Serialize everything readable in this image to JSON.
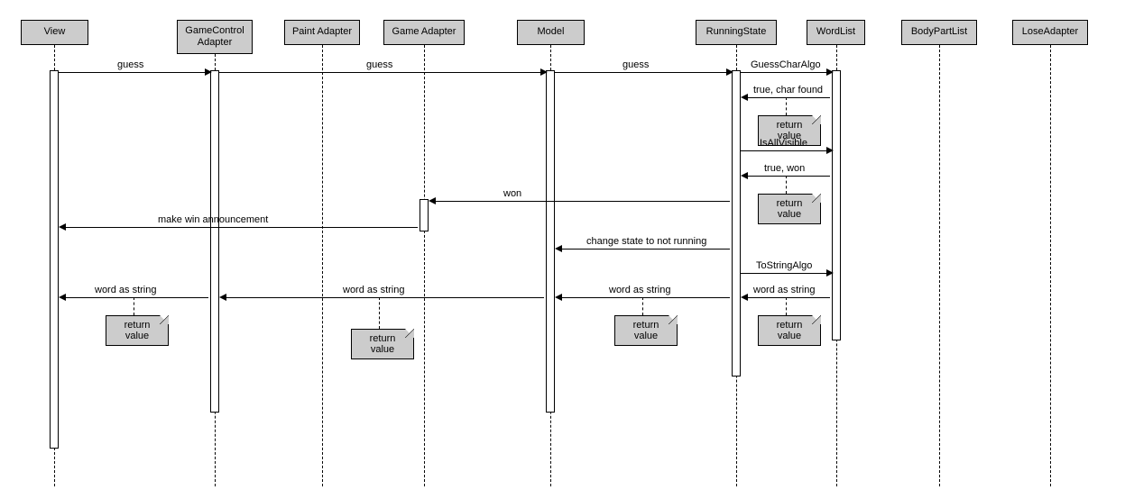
{
  "participants": {
    "view": "View",
    "gamecontrol": "GameControl Adapter",
    "paint": "Paint Adapter",
    "game": "Game Adapter",
    "model": "Model",
    "running": "RunningState",
    "wordlist": "WordList",
    "bodypart": "BodyPartList",
    "lose": "LoseAdapter"
  },
  "messages": {
    "guess": "guess",
    "guesscharalgo": "GuessCharAlgo",
    "truecharfound": "true, char found",
    "isallvisible": "IsAllVisible",
    "truewon": "true, won",
    "won": "won",
    "makewin": "make win announcement",
    "changestate": "change state to not running",
    "tostringalgo": "ToStringAlgo",
    "wordasstring": "word as string"
  },
  "notes": {
    "returnvalue": "return value"
  }
}
